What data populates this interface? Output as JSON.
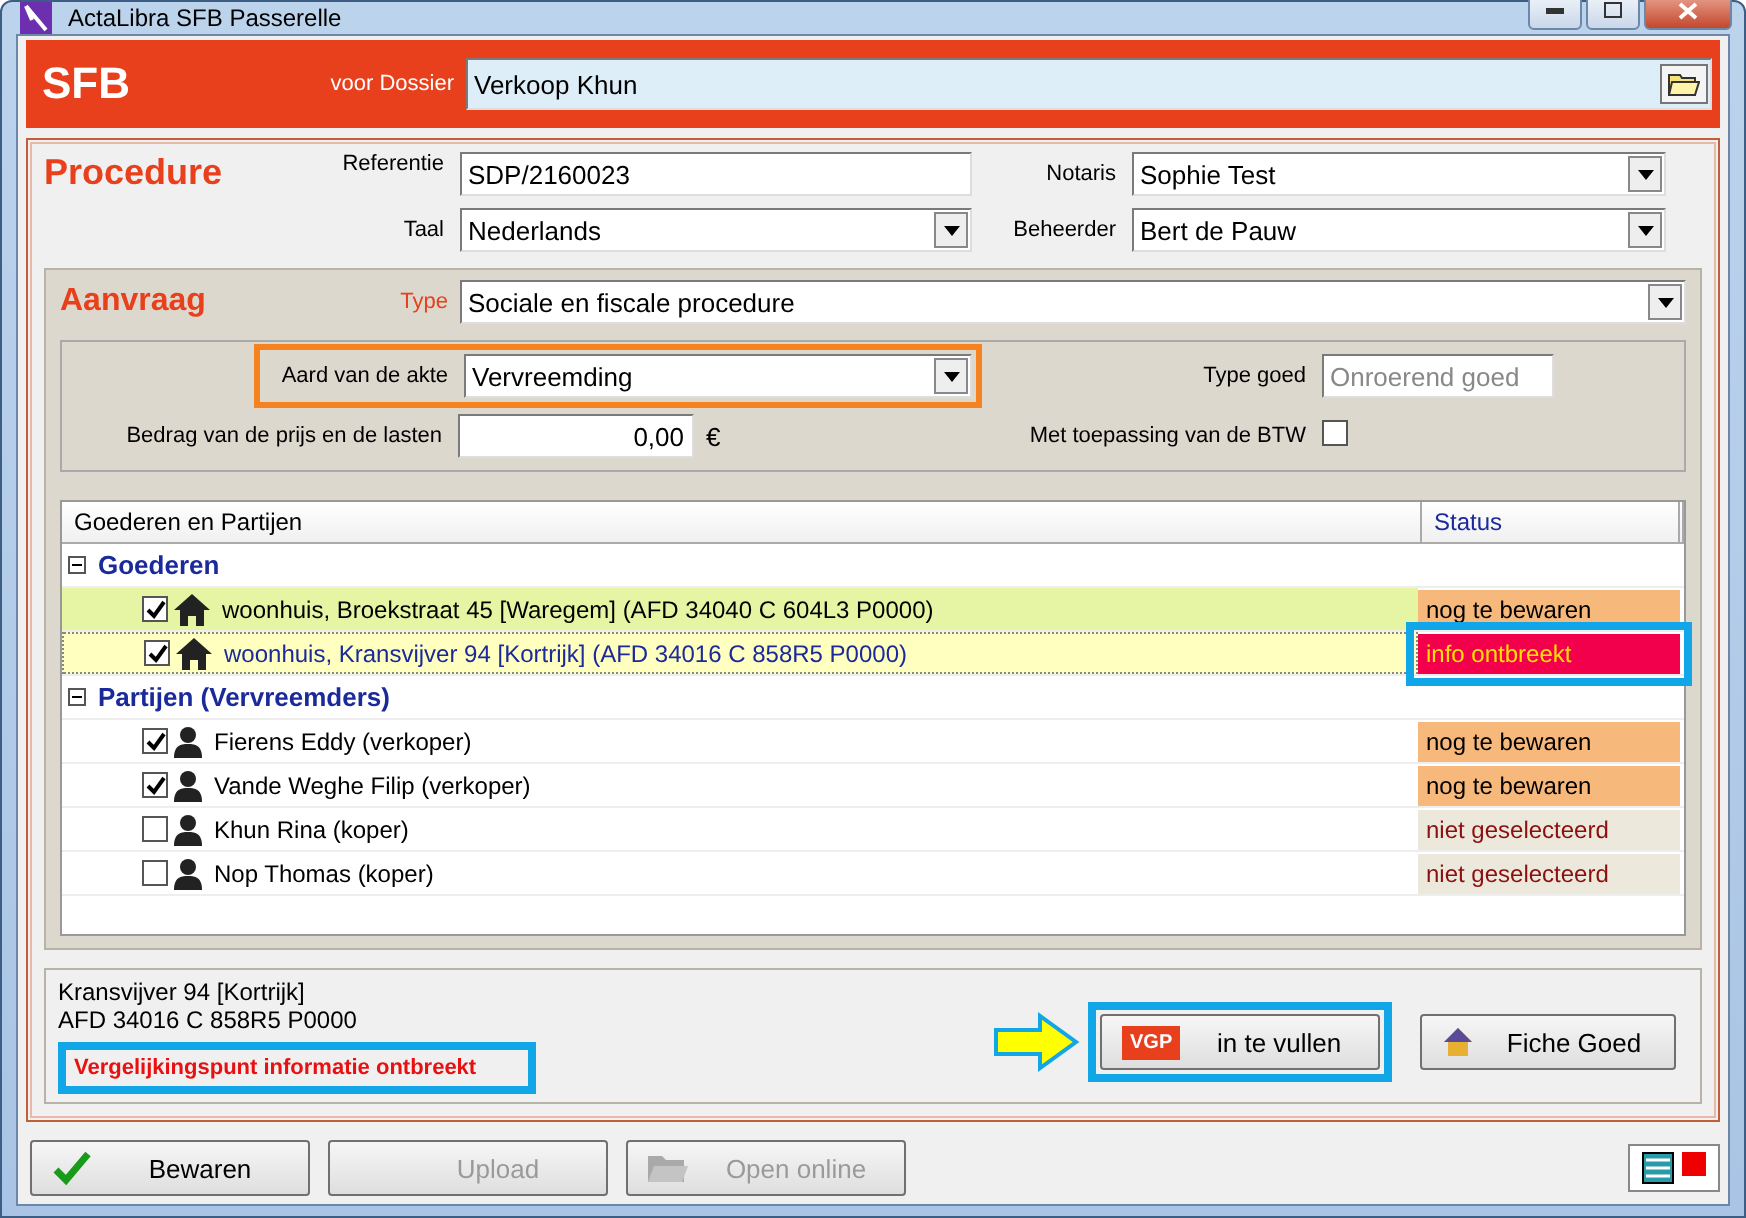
{
  "window": {
    "title": "ActaLibra SFB Passerelle"
  },
  "header": {
    "title": "SFB",
    "dossier_label": "voor Dossier",
    "dossier_value": "Verkoop Khun"
  },
  "procedure": {
    "title": "Procedure",
    "fields": [
      {
        "label": "Referentie",
        "value": "SDP/2160023",
        "kind": "text"
      },
      {
        "label": "Notaris",
        "value": "Sophie Test",
        "kind": "dropdown"
      },
      {
        "label": "Taal",
        "value": "Nederlands",
        "kind": "dropdown"
      },
      {
        "label": "Beheerder",
        "value": "Bert de Pauw",
        "kind": "dropdown"
      }
    ]
  },
  "aanvraag": {
    "title": "Aanvraag",
    "type_label": "Type",
    "type_value": "Sociale en fiscale procedure",
    "aard_label": "Aard van de akte",
    "aard_value": "Vervreemding",
    "aard_highlighted": true,
    "type_goed_label": "Type goed",
    "type_goed_value": "Onroerend goed",
    "bedrag_label": "Bedrag van de prijs en de lasten",
    "bedrag_value": "0,00",
    "currency": "€",
    "btw_label": "Met toepassing van de BTW",
    "btw_checked": false
  },
  "tree": {
    "columns": [
      "Goederen en Partijen",
      "Status"
    ],
    "groups": [
      {
        "label": "Goederen",
        "expanded": true,
        "children": [
          {
            "kind": "property",
            "label": "woonhuis, Broekstraat 45 [Waregem] (AFD 34040 C 604L3 P0000)",
            "checked": true,
            "selected": false,
            "hovered": true,
            "status": "nog te bewaren",
            "color": "#f7b87c",
            "highlighted": false
          },
          {
            "kind": "property",
            "label": "woonhuis, Kransvijver 94 [Kortrijk] (AFD 34016 C 858R5 P0000)",
            "checked": true,
            "selected": true,
            "hovered": false,
            "status": "info ontbreekt",
            "color": "#f2004c",
            "highlighted": true
          }
        ]
      },
      {
        "label": "Partijen (Vervreemders)",
        "expanded": true,
        "children": [
          {
            "kind": "person",
            "label": "Fierens Eddy (verkoper)",
            "checked": true,
            "selected": false,
            "hovered": false,
            "status": "nog te bewaren",
            "color": "#f7b87c",
            "highlighted": false
          },
          {
            "kind": "person",
            "label": "Vande Weghe Filip (verkoper)",
            "checked": true,
            "selected": false,
            "hovered": false,
            "status": "nog te bewaren",
            "color": "#f7b87c",
            "highlighted": false
          },
          {
            "kind": "person",
            "label": "Khun Rina (koper)",
            "checked": false,
            "selected": false,
            "hovered": false,
            "status": "niet geselecteerd",
            "color": "#ece8dc",
            "highlighted": false
          },
          {
            "kind": "person",
            "label": "Nop Thomas (koper)",
            "checked": false,
            "selected": false,
            "hovered": false,
            "status": "niet geselecteerd",
            "color": "#ece8dc",
            "highlighted": false
          }
        ]
      }
    ]
  },
  "info": {
    "lines": [
      "Kransvijver 94 [Kortrijk]",
      "AFD 34016 C 858R5 P0000"
    ],
    "warning": "Vergelijkingspunt informatie ontbreekt",
    "warning_highlighted": true,
    "buttons": [
      {
        "kind": "vgp",
        "badge": "VGP",
        "label": "in te vullen",
        "highlighted": true
      },
      {
        "kind": "fiche",
        "label": "Fiche Goed",
        "highlighted": false
      }
    ]
  },
  "buttons": [
    {
      "kind": "save",
      "label": "Bewaren",
      "disabled": false
    },
    {
      "kind": "upload",
      "label": "Upload",
      "disabled": true
    },
    {
      "kind": "open",
      "label": "Open online",
      "disabled": true
    }
  ]
}
